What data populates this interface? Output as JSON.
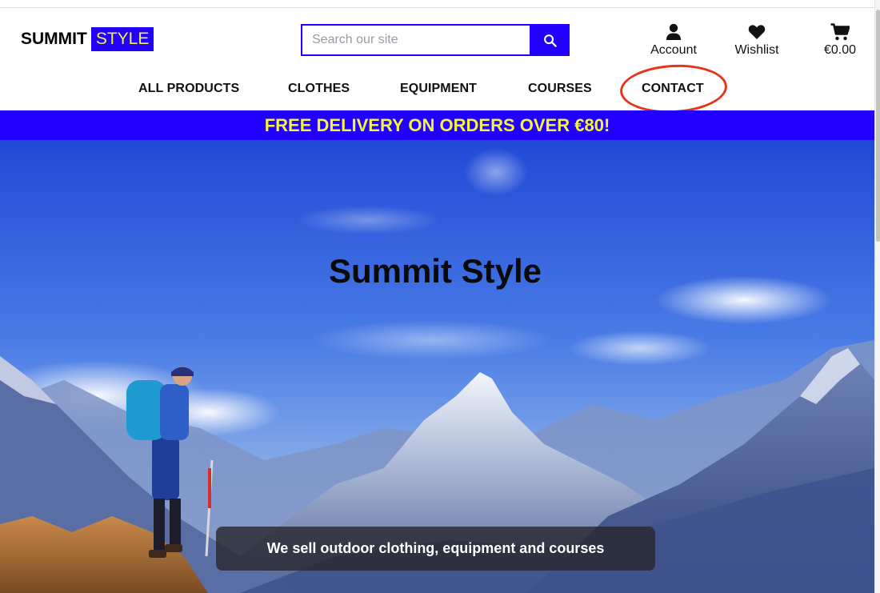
{
  "header": {
    "logo_part1": "SUMMIT",
    "logo_part2": "STYLE",
    "search_placeholder": "Search our site",
    "links": [
      {
        "label": "Account",
        "icon": "user-icon"
      },
      {
        "label": "Wishlist",
        "icon": "heart-icon"
      },
      {
        "label": "€0.00",
        "icon": "cart-icon"
      }
    ]
  },
  "nav": {
    "items": [
      {
        "label": "ALL PRODUCTS"
      },
      {
        "label": "CLOTHES"
      },
      {
        "label": "EQUIPMENT"
      },
      {
        "label": "COURSES"
      },
      {
        "label": "CONTACT"
      }
    ]
  },
  "promo": {
    "text": "FREE DELIVERY ON ORDERS OVER €80!"
  },
  "hero": {
    "title": "Summit Style",
    "caption": "We sell outdoor clothing, equipment and courses"
  },
  "colors": {
    "brand_blue": "#2200ff",
    "brand_yellow": "#f4f43c",
    "annotation_red": "#e8341c"
  }
}
